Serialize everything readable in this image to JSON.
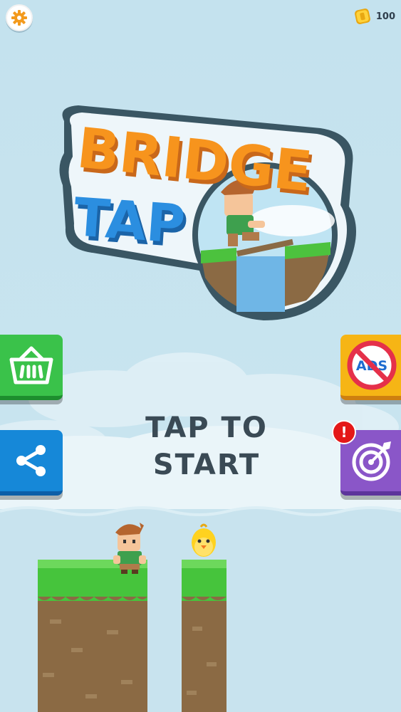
{
  "header": {
    "coins": "100",
    "settings_icon": "gear-icon",
    "coin_icon": "coin-icon"
  },
  "logo": {
    "line1": "BRIDGE",
    "line2": "TAP"
  },
  "buttons": {
    "shop_icon": "basket-icon",
    "noads_text": "ADS",
    "share_icon": "share-icon",
    "missions_icon": "target-icon",
    "alert": "!"
  },
  "prompt": {
    "line1": "TAP TO",
    "line2": "START"
  },
  "colors": {
    "shop": "#3ac24a",
    "noads": "#f6b515",
    "share": "#1688d8",
    "missions": "#8a56c8",
    "logo_orange": "#f7941d",
    "logo_blue": "#2b8ee0"
  }
}
